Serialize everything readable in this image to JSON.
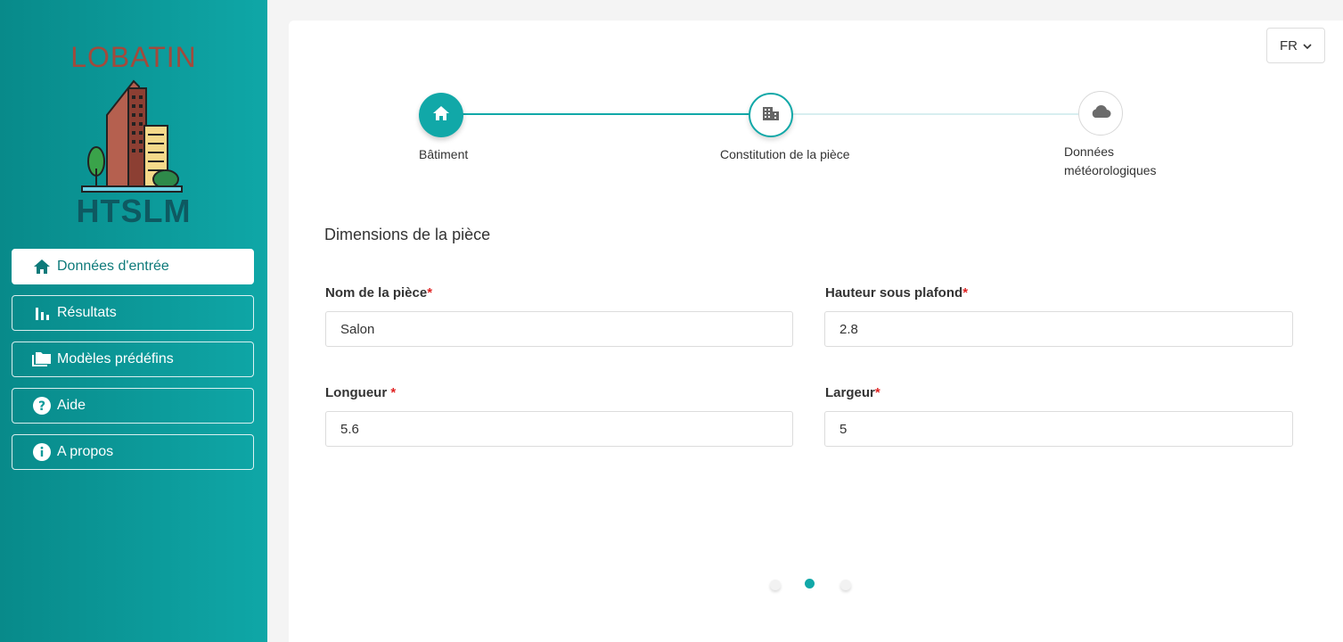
{
  "logo": {
    "top_text": "LOBATIN",
    "bottom_text": "HTSLM"
  },
  "sidebar": {
    "items": [
      {
        "label": "Données d'entrée",
        "icon": "home-icon",
        "active": true
      },
      {
        "label": "Résultats",
        "icon": "bar-chart-icon",
        "active": false
      },
      {
        "label": "Modèles prédéfins",
        "icon": "folder-icon",
        "active": false
      },
      {
        "label": "Aide",
        "icon": "help-icon",
        "active": false
      },
      {
        "label": "A propos",
        "icon": "info-icon",
        "active": false
      }
    ]
  },
  "language": {
    "value": "FR"
  },
  "stepper": {
    "steps": [
      {
        "label": "Bâtiment",
        "icon": "home-icon",
        "state": "done"
      },
      {
        "label": "Constitution de la pièce",
        "icon": "building-icon",
        "state": "current"
      },
      {
        "label_line1": "Données",
        "label_line2": "météorologiques",
        "icon": "cloud-icon",
        "state": "pending"
      }
    ]
  },
  "form": {
    "section_title": "Dimensions de la pièce",
    "fields": {
      "room_name": {
        "label": "Nom de la pièce",
        "required": "*",
        "value": "Salon"
      },
      "ceiling_height": {
        "label": "Hauteur sous plafond",
        "required": "*",
        "value": "2.8"
      },
      "length": {
        "label": "Longueur ",
        "required": "*",
        "value": "5.6"
      },
      "width": {
        "label": "Largeur",
        "required": "*",
        "value": "5"
      }
    }
  },
  "pagination": {
    "count": 3,
    "current": 2
  },
  "colors": {
    "accent": "#11a8a8",
    "sidebar_dark": "#088a8a",
    "required": "#e02424"
  }
}
